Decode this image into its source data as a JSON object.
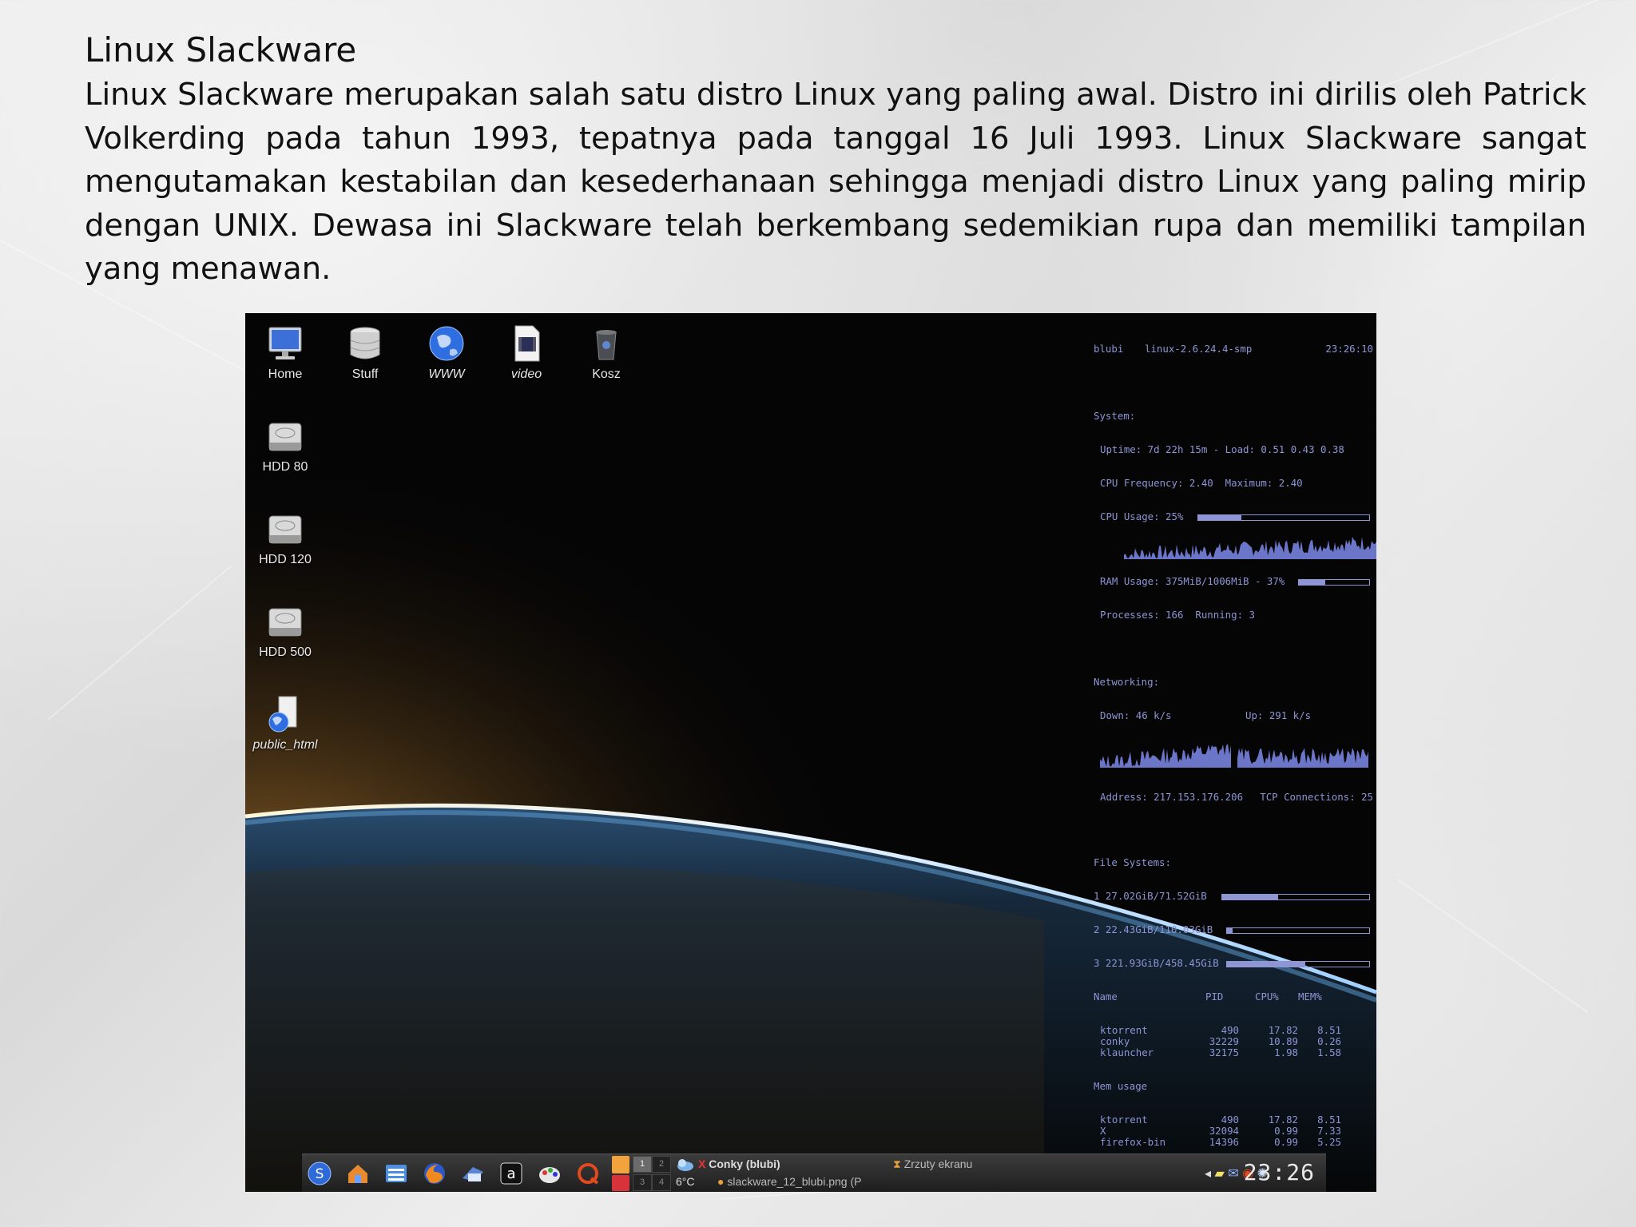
{
  "slide": {
    "title": "Linux Slackware",
    "paragraph": "Linux Slackware merupakan salah satu distro Linux yang paling awal. Distro ini dirilis oleh  Patrick Volkerding  pada  tahun  1993,  tepatnya  pada  tanggal 16  Juli  1993.  Linux Slackware sangat mengutamakan kestabilan dan kesederhanaan sehingga menjadi distro Linux  yang  paling  mirip dengan  UNIX.  Dewasa  ini  Slackware  telah  berkembang sedemikian rupa dan memiliki tampilan yang menawan."
  },
  "desktop": {
    "icons": [
      {
        "label": "Home",
        "icon": "monitor-icon"
      },
      {
        "label": "Stuff",
        "icon": "database-icon"
      },
      {
        "label": "WWW",
        "icon": "globe-icon"
      },
      {
        "label": "video",
        "icon": "video-file-icon"
      },
      {
        "label": "Kosz",
        "icon": "trash-icon"
      },
      {
        "label": "HDD 80",
        "icon": "hard-drive-icon"
      },
      {
        "label": "HDD 120",
        "icon": "hard-drive-icon"
      },
      {
        "label": "HDD 500",
        "icon": "hard-drive-icon"
      },
      {
        "label": "public_html",
        "icon": "web-folder-icon"
      }
    ]
  },
  "conky": {
    "host": "blubi",
    "kernel": "linux-2.6.24.4-smp",
    "time": "23:26:10",
    "system_header": "System:",
    "uptime": "Uptime: 7d 22h 15m - Load: 0.51 0.43 0.38",
    "cpu_freq": "CPU Frequency: 2.40  Maximum: 2.40",
    "cpu_usage": "CPU Usage: 25%",
    "cpu_usage_value": 0.25,
    "ram_usage": "RAM Usage: 375MiB/1006MiB - 37%",
    "ram_usage_value": 0.37,
    "processes": "Processes: 166  Running: 3",
    "net_header": "Networking:",
    "down": "Down: 46 k/s",
    "up": "Up: 291 k/s",
    "address": "Address: 217.153.176.206",
    "tcp": "TCP Connections: 25",
    "fs_header": "File Systems:",
    "filesystems": [
      {
        "label": "1 27.02GiB/71.52GiB",
        "value": 0.38
      },
      {
        "label": "2 22.43GiB/110.03GiB",
        "value": 0.04
      },
      {
        "label": "3 221.93GiB/458.45GiB",
        "value": 0.55
      }
    ],
    "proc_header": {
      "name": "Name",
      "pid": "PID",
      "cpu": "CPU%",
      "mem": "MEM%"
    },
    "top_cpu": [
      {
        "name": "ktorrent",
        "pid": "490",
        "cpu": "17.82",
        "mem": "8.51"
      },
      {
        "name": "conky",
        "pid": "32229",
        "cpu": "10.89",
        "mem": "0.26"
      },
      {
        "name": "klauncher",
        "pid": "32175",
        "cpu": "1.98",
        "mem": "1.58"
      }
    ],
    "mem_header": "Mem usage",
    "top_mem": [
      {
        "name": "ktorrent",
        "pid": "490",
        "cpu": "17.82",
        "mem": "8.51"
      },
      {
        "name": "X",
        "pid": "32094",
        "cpu": "0.99",
        "mem": "7.33"
      },
      {
        "name": "firefox-bin",
        "pid": "14396",
        "cpu": "0.99",
        "mem": "5.25"
      }
    ]
  },
  "taskbar": {
    "launchers": [
      "kmenu-icon",
      "home-folder-icon",
      "file-manager-icon",
      "firefox-icon",
      "thunderbird-icon",
      "amarok-icon",
      "paint-icon",
      "quassel-icon"
    ],
    "pager": [
      "1",
      "2",
      "3",
      "4"
    ],
    "tasks": [
      {
        "label": "Conky (blubi)"
      },
      {
        "label": "slackware_12_blubi.png (P"
      },
      {
        "label": "Zrzuty ekranu"
      }
    ],
    "weather": "6°C",
    "clock": "23:26"
  }
}
